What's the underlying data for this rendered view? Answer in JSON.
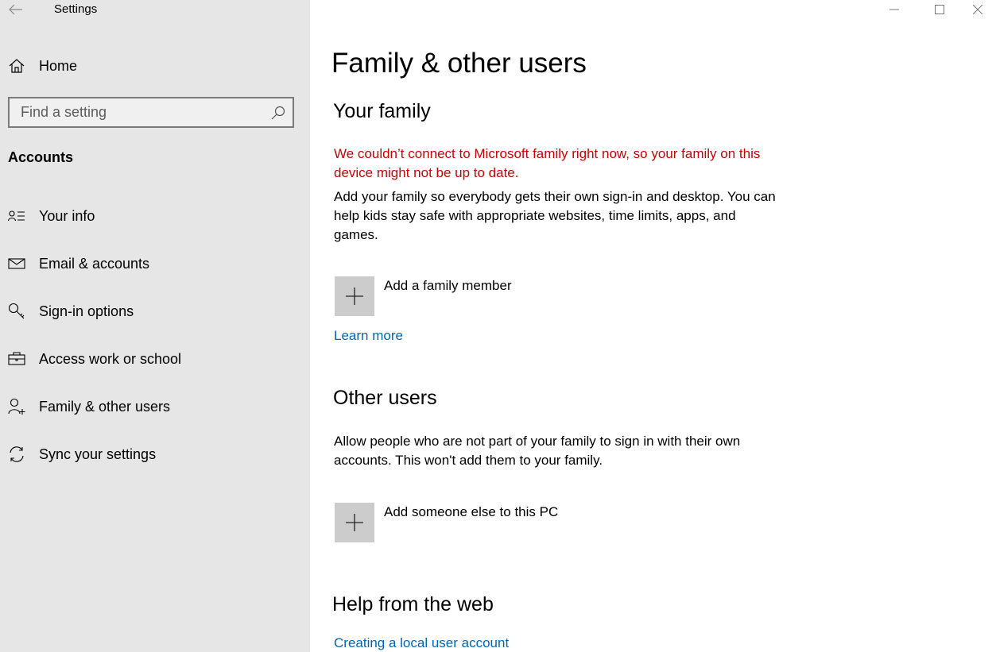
{
  "window": {
    "title": "Settings",
    "controls": [
      "minimize",
      "maximize",
      "close"
    ]
  },
  "sidebar": {
    "home_label": "Home",
    "search": {
      "placeholder": "Find a setting"
    },
    "section_label": "Accounts",
    "items": [
      {
        "label": "Your info",
        "icon": "contact-info-icon"
      },
      {
        "label": "Email & accounts",
        "icon": "mail-icon"
      },
      {
        "label": "Sign-in options",
        "icon": "key-icon"
      },
      {
        "label": "Access work or school",
        "icon": "briefcase-icon"
      },
      {
        "label": "Family & other users",
        "icon": "add-person-icon"
      },
      {
        "label": "Sync your settings",
        "icon": "sync-icon"
      }
    ]
  },
  "main": {
    "title": "Family & other users",
    "your_family": {
      "heading": "Your family",
      "error": "We couldn’t connect to Microsoft family right now, so your family on this device might not be up to date.",
      "description": "Add your family so everybody gets their own sign-in and desktop. You can help kids stay safe with appropriate websites, time limits, apps, and games.",
      "add_label": "Add a family member",
      "learn_more": "Learn more"
    },
    "other_users": {
      "heading": "Other users",
      "description": "Allow people who are not part of your family to sign in with their own accounts. This won't add them to your family.",
      "add_label": "Add someone else to this PC"
    },
    "help": {
      "heading": "Help from the web",
      "link": "Creating a local user account"
    }
  },
  "colors": {
    "sidebar_bg": "#e6e6e6",
    "error": "#c50500",
    "link": "#0067b8",
    "tile": "#cccccc"
  }
}
